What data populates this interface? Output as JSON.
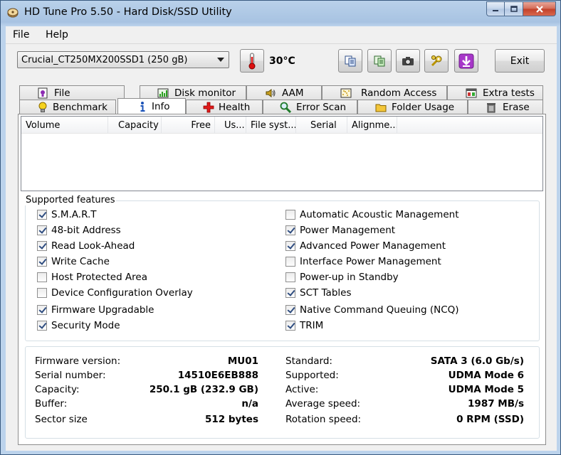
{
  "window": {
    "title": "HD Tune Pro 5.50 - Hard Disk/SSD Utility"
  },
  "menu": [
    "File",
    "Help"
  ],
  "toolbar": {
    "drive": "Crucial_CT250MX200SSD1 (250 gB)",
    "temperature": "30°C",
    "exit_label": "Exit"
  },
  "tabs_top": [
    {
      "label": "File Benchmark",
      "icon": "file-benchmark-icon"
    },
    {
      "label": "Disk monitor",
      "icon": "disk-monitor-icon"
    },
    {
      "label": "AAM",
      "icon": "speaker-icon"
    },
    {
      "label": "Random Access",
      "icon": "random-access-icon"
    },
    {
      "label": "Extra tests",
      "icon": "extra-tests-icon"
    }
  ],
  "tabs_bottom": [
    {
      "label": "Benchmark",
      "icon": "lightbulb-icon"
    },
    {
      "label": "Info",
      "icon": "info-icon",
      "active": true
    },
    {
      "label": "Health",
      "icon": "health-cross-icon"
    },
    {
      "label": "Error Scan",
      "icon": "magnifier-icon"
    },
    {
      "label": "Folder Usage",
      "icon": "folder-icon"
    },
    {
      "label": "Erase",
      "icon": "trash-icon"
    }
  ],
  "volume_table": {
    "columns": [
      "Volume",
      "Capacity",
      "Free",
      "Us...",
      "File syst...",
      "Serial",
      "Alignme..."
    ]
  },
  "features": {
    "legend": "Supported features",
    "left": [
      {
        "label": "S.M.A.R.T",
        "checked": true
      },
      {
        "label": "48-bit Address",
        "checked": true
      },
      {
        "label": "Read Look-Ahead",
        "checked": true
      },
      {
        "label": "Write Cache",
        "checked": true
      },
      {
        "label": "Host Protected Area",
        "checked": false
      },
      {
        "label": "Device Configuration Overlay",
        "checked": false
      },
      {
        "label": "Firmware Upgradable",
        "checked": true
      },
      {
        "label": "Security Mode",
        "checked": true
      }
    ],
    "right": [
      {
        "label": "Automatic Acoustic Management",
        "checked": false
      },
      {
        "label": "Power Management",
        "checked": true
      },
      {
        "label": "Advanced Power Management",
        "checked": true
      },
      {
        "label": "Interface Power Management",
        "checked": false
      },
      {
        "label": "Power-up in Standby",
        "checked": false
      },
      {
        "label": "SCT Tables",
        "checked": true
      },
      {
        "label": "Native Command Queuing (NCQ)",
        "checked": true
      },
      {
        "label": "TRIM",
        "checked": true
      }
    ]
  },
  "info": {
    "left": [
      {
        "label": "Firmware version:",
        "value": "MU01"
      },
      {
        "label": "Serial number:",
        "value": "14510E6EB888"
      },
      {
        "label": "Capacity:",
        "value": "250.1 gB (232.9 GB)"
      },
      {
        "label": "Buffer:",
        "value": "n/a"
      },
      {
        "label": "Sector size",
        "value": "512 bytes"
      }
    ],
    "right": [
      {
        "label": "Standard:",
        "value": "SATA 3 (6.0 Gb/s)"
      },
      {
        "label": "Supported:",
        "value": "UDMA Mode 6"
      },
      {
        "label": "Active:",
        "value": "UDMA Mode 5"
      },
      {
        "label": "Average speed:",
        "value": "1987 MB/s"
      },
      {
        "label": "Rotation speed:",
        "value": "0 RPM (SSD)"
      }
    ]
  },
  "colors": {
    "title_bar": "#b9d1ea",
    "close_button": "#c2412a",
    "panel_bg": "#ffffff",
    "window_bg": "#f0f0f0"
  }
}
